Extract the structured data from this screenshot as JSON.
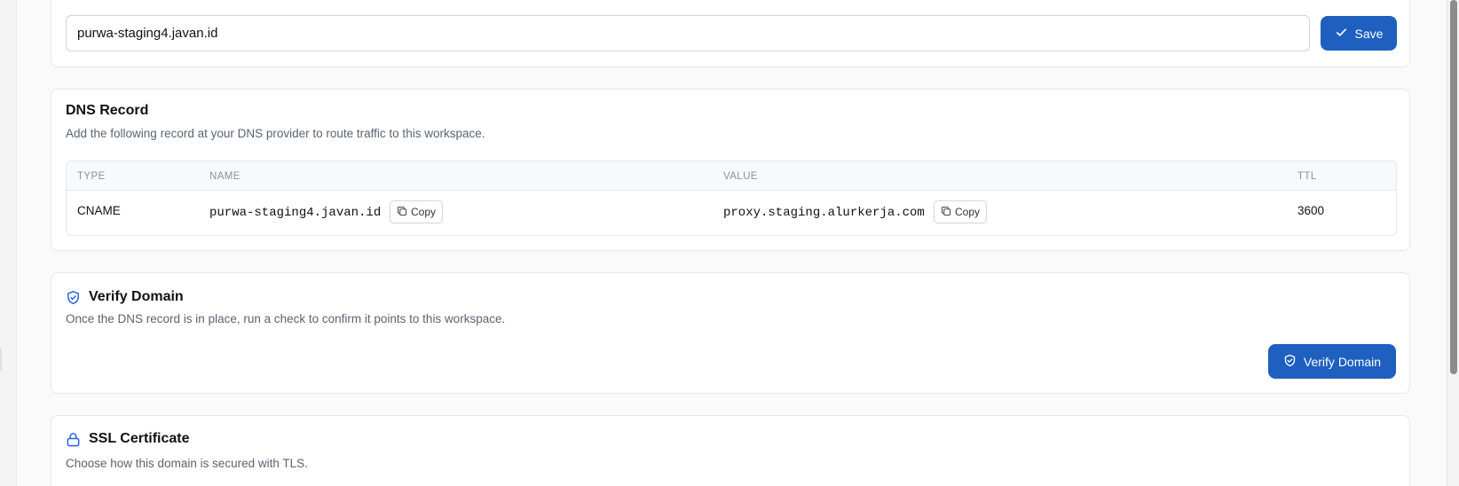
{
  "domain": {
    "value": "purwa-staging4.javan.id",
    "save_label": "Save"
  },
  "dns": {
    "title": "DNS Record",
    "description": "Add the following record at your DNS provider to route traffic to this workspace.",
    "columns": [
      "TYPE",
      "NAME",
      "VALUE",
      "TTL"
    ],
    "row": {
      "type": "CNAME",
      "name": "purwa-staging4.javan.id",
      "value": "proxy.staging.alurkerja.com",
      "ttl": "3600"
    },
    "copy_label": "Copy"
  },
  "verify": {
    "title": "Verify Domain",
    "description": "Once the DNS record is in place, run a check to confirm it points to this workspace.",
    "button_label": "Verify Domain"
  },
  "ssl": {
    "title": "SSL Certificate",
    "description": "Choose how this domain is secured with TLS."
  },
  "colors": {
    "primary": "#1f5fbf",
    "icon_blue": "#2563eb"
  },
  "icons": {
    "save": "check-icon",
    "copy": "copy-icon",
    "verify": "shield-check-icon",
    "ssl": "lock-icon"
  }
}
